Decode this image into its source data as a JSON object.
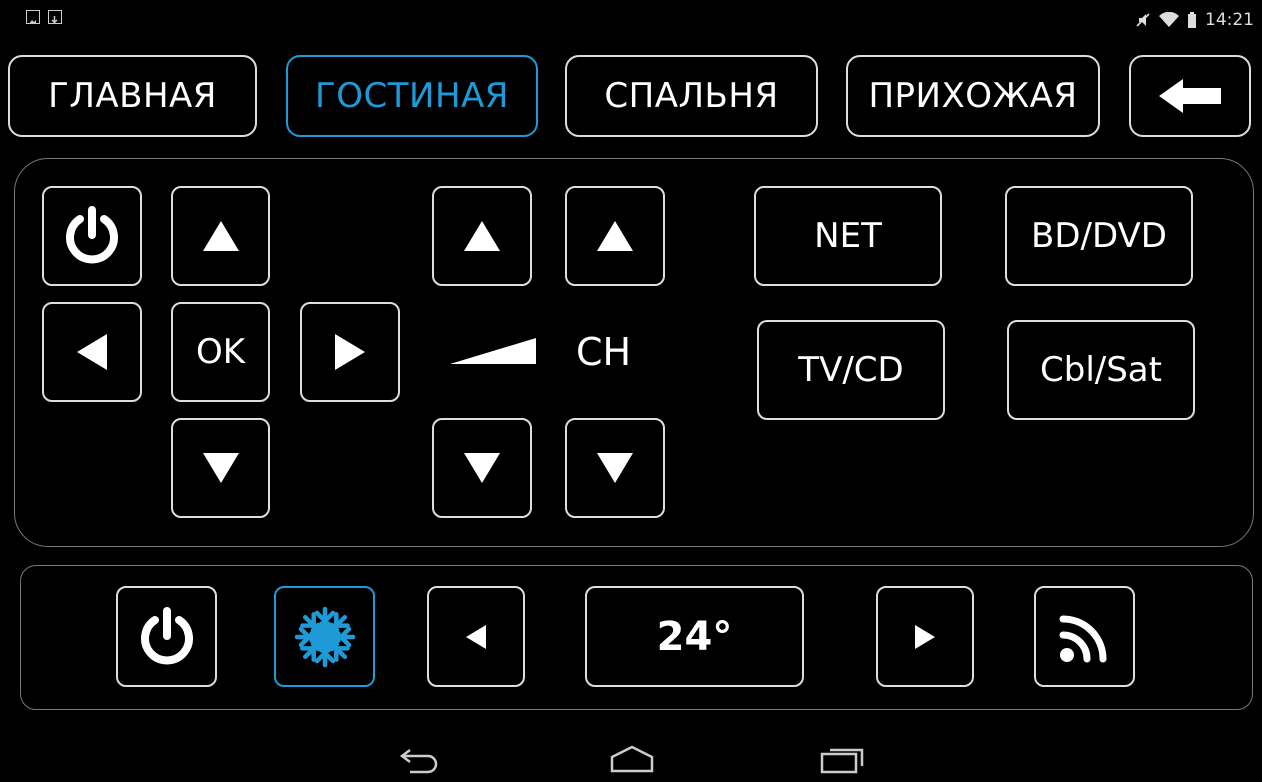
{
  "status_bar": {
    "time": "14:21",
    "icons": [
      "gallery-icon",
      "download-icon",
      "mute-icon",
      "wifi-icon",
      "battery-icon"
    ]
  },
  "tabs": [
    {
      "label": "ГЛАВНАЯ",
      "active": false
    },
    {
      "label": "ГОСТИНАЯ",
      "active": true
    },
    {
      "label": "СПАЛЬНЯ",
      "active": false
    },
    {
      "label": "ПРИХОЖАЯ",
      "active": false
    }
  ],
  "back_button_icon": "back-arrow-icon",
  "remote": {
    "power_icon": "power-icon",
    "dpad": {
      "ok_label": "OK"
    },
    "volume_icon": "volume-icon",
    "channel_label": "CH",
    "sources": [
      "NET",
      "BD/DVD",
      "TV/CD",
      "Cbl/Sat"
    ]
  },
  "climate": {
    "power_icon": "power-icon",
    "mode_icon": "snowflake-icon",
    "mode_active": true,
    "temperature": "24°",
    "wifi_icon": "wireless-signal-icon"
  },
  "nav_bar": {
    "icons": [
      "back-icon",
      "home-icon",
      "recent-apps-icon"
    ]
  },
  "colors": {
    "accent": "#1e9ad6",
    "border": "#dddddd",
    "background": "#000000"
  }
}
